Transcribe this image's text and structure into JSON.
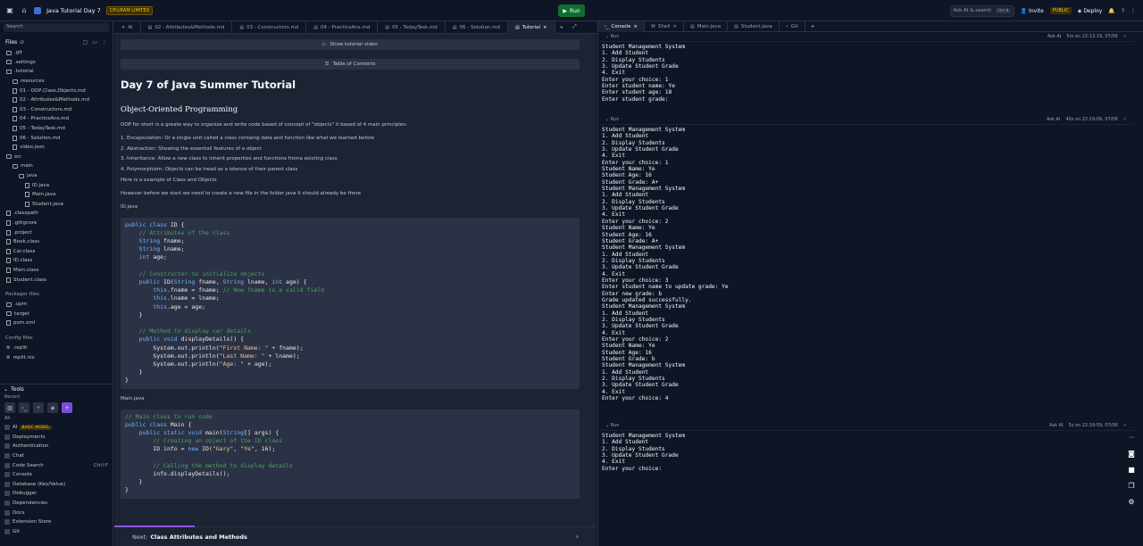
{
  "topbar": {
    "project_title": "Java Tutorial Day 7",
    "cpu_badge": "CPU/RAM LIMITED",
    "run_label": "Run",
    "search_ai_label": "Ask AI & search",
    "search_shortcut": "Ctrl K",
    "invite_label": "Invite",
    "public_label": "PUBLIC",
    "deploy_label": "Deploy"
  },
  "sidebar": {
    "search_placeholder": "Search",
    "files_label": "Files",
    "files": [
      {
        "name": ".git",
        "indent": 0,
        "kind": "folder"
      },
      {
        "name": ".settings",
        "indent": 0,
        "kind": "folder"
      },
      {
        "name": ".tutorial",
        "indent": 0,
        "kind": "folder"
      },
      {
        "name": "resources",
        "indent": 1,
        "kind": "folder"
      },
      {
        "name": "01 - OOP,Class,Objects.md",
        "indent": 1,
        "kind": "file"
      },
      {
        "name": "02 - Attributes&Methods.md",
        "indent": 1,
        "kind": "file"
      },
      {
        "name": "03 - Constructors.md",
        "indent": 1,
        "kind": "file"
      },
      {
        "name": "04 - PracticeAns.md",
        "indent": 1,
        "kind": "file"
      },
      {
        "name": "05 - TodayTask.md",
        "indent": 1,
        "kind": "file"
      },
      {
        "name": "06 - Solution.md",
        "indent": 1,
        "kind": "file"
      },
      {
        "name": "video.json",
        "indent": 1,
        "kind": "file"
      },
      {
        "name": "src",
        "indent": 0,
        "kind": "folder"
      },
      {
        "name": "main",
        "indent": 1,
        "kind": "folder"
      },
      {
        "name": "java",
        "indent": 2,
        "kind": "folder"
      },
      {
        "name": "ID.java",
        "indent": 3,
        "kind": "file"
      },
      {
        "name": "Main.java",
        "indent": 3,
        "kind": "file"
      },
      {
        "name": "Student.java",
        "indent": 3,
        "kind": "file"
      },
      {
        "name": ".classpath",
        "indent": 0,
        "kind": "file"
      },
      {
        "name": ".gitignore",
        "indent": 0,
        "kind": "file"
      },
      {
        "name": ".project",
        "indent": 0,
        "kind": "file"
      },
      {
        "name": "Book.class",
        "indent": 0,
        "kind": "file"
      },
      {
        "name": "Car.class",
        "indent": 0,
        "kind": "file"
      },
      {
        "name": "ID.class",
        "indent": 0,
        "kind": "file"
      },
      {
        "name": "Main.class",
        "indent": 0,
        "kind": "file"
      },
      {
        "name": "Student.class",
        "indent": 0,
        "kind": "file"
      }
    ],
    "packager_label": "Packager files",
    "packager": [
      {
        "name": ".upm",
        "kind": "folder"
      },
      {
        "name": "target",
        "kind": "folder"
      },
      {
        "name": "pom.xml",
        "kind": "file"
      }
    ],
    "config_label": "Config files",
    "config": [
      {
        "name": ".replit"
      },
      {
        "name": "replit.nix"
      }
    ],
    "tools_label": "Tools",
    "recent_label": "Recent",
    "all_label": "All",
    "tools": [
      {
        "name": "AI",
        "badge": "BASIC MODEL",
        "shortcut": ""
      },
      {
        "name": "Deployments",
        "badge": "",
        "shortcut": ""
      },
      {
        "name": "Authentication",
        "badge": "",
        "shortcut": ""
      },
      {
        "name": "Chat",
        "badge": "",
        "shortcut": ""
      },
      {
        "name": "Code Search",
        "badge": "",
        "shortcut": "Ctrl⇧F"
      },
      {
        "name": "Console",
        "badge": "",
        "shortcut": ""
      },
      {
        "name": "Database (Key/Value)",
        "badge": "",
        "shortcut": ""
      },
      {
        "name": "Debugger",
        "badge": "",
        "shortcut": ""
      },
      {
        "name": "Dependencies",
        "badge": "",
        "shortcut": ""
      },
      {
        "name": "Docs",
        "badge": "",
        "shortcut": ""
      },
      {
        "name": "Extension Store",
        "badge": "",
        "shortcut": ""
      },
      {
        "name": "Git",
        "badge": "",
        "shortcut": ""
      }
    ]
  },
  "center": {
    "tabs": [
      "AI",
      "02 - Attributes&Methods.md",
      "03 - Constructors.md",
      "04 - PracticeAns.md",
      "05 - TodayTask.md",
      "06 - Solution.md",
      "Tutorial"
    ],
    "show_video": "Show tutorial video",
    "toc": "Table of Contents",
    "title": "Day 7 of Java Summer Tutorial",
    "subtitle": "Object-Oriented Programming",
    "intro": "OOP for short is a greate way to organize and write code based of concept of \"objects\" it based of 4 main principles:",
    "principles": [
      "1. Encapsulation: Or a single unit called a class containg data and function like what we learned before",
      "2. Abstraction: Showing the essentail features of a object",
      "3. Inheritance: Allow a new class to inherit properties and functions froma existing class",
      "4. Polymorphism: Objects can be tread as a istance of their parent class"
    ],
    "example": "Here is a example of Class and Objects",
    "before": "However before we start we need to create a new file in the folder java it should already be there",
    "file1": "ID.java",
    "file2": "Main.java",
    "next_prefix": "Next:",
    "next_title": "Class Attributes and Methods"
  },
  "right": {
    "tabs": [
      "Console",
      "Shell",
      "Main.java",
      "Student.java",
      "Git"
    ],
    "run_label": "Run",
    "ask_ai": "Ask AI",
    "blocks": [
      {
        "time": "5m on 22:13:19, 07/06",
        "output": "Student Management System\n1. Add Student\n2. Display Students\n3. Update Student Grade\n4. Exit\nEnter your choice: 1\nEnter student name: Ye\nEnter student age: 18\nEnter student grade:"
      },
      {
        "time": "40s on 22:19:09, 07/06",
        "output": "Student Management System\n1. Add Student\n2. Display Students\n3. Update Student Grade\n4. Exit\nEnter your choice: 1\nStudent Name: Ye\nStudent Age: 16\nStudent Grade: A+\nStudent Management System\n1. Add Student\n2. Display Students\n3. Update Student Grade\n4. Exit\nEnter your choice: 2\nStudent Name: Ye\nStudent Age: 16\nStudent Grade: A+\nStudent Management System\n1. Add Student\n2. Display Students\n3. Update Student Grade\n4. Exit\nEnter your choice: 3\nEnter student name to update grade: Ye\nEnter new grade: b\nGrade updated successfully.\nStudent Management System\n1. Add Student\n2. Display Students\n3. Update Student Grade\n4. Exit\nEnter your choice: 2\nStudent Name: Ye\nStudent Age: 16\nStudent Grade: b\nStudent Management System\n1. Add Student\n2. Display Students\n3. Update Student Grade\n4. Exit\nEnter your choice: 4"
      },
      {
        "time": "5s on 22:19:59, 07/06",
        "output": "Student Management System\n1. Add Student\n2. Display Students\n3. Update Student Grade\n4. Exit\nEnter your choice:"
      }
    ]
  }
}
